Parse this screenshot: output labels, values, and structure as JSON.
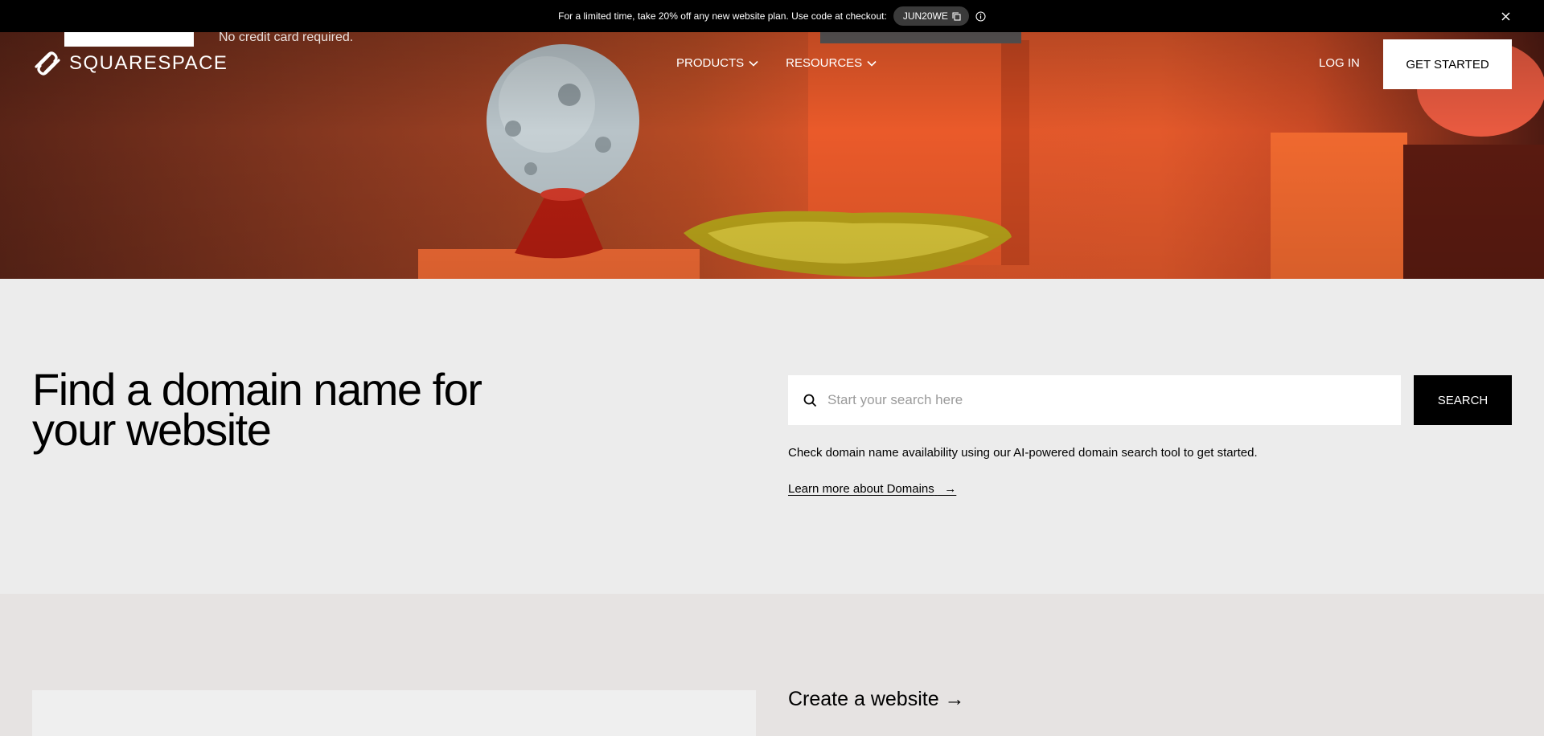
{
  "promo": {
    "text": "For a limited time, take 20% off any new website plan. Use code at checkout:",
    "code": "JUN20WE"
  },
  "hero": {
    "partial_caption": "No credit card required."
  },
  "header": {
    "brand": "SQUARESPACE",
    "nav": [
      {
        "label": "PRODUCTS"
      },
      {
        "label": "RESOURCES"
      }
    ],
    "login": "LOG IN",
    "cta": "GET STARTED"
  },
  "domain": {
    "title": "Find a domain name for your website",
    "search_placeholder": "Start your search here",
    "search_button": "SEARCH",
    "helper": "Check domain name availability using our AI-powered domain search tool to get started.",
    "learn_more": "Learn more about Domains"
  },
  "next": {
    "create": "Create a website →"
  },
  "colors": {
    "accent_orange": "#e3592b",
    "black": "#000000"
  }
}
